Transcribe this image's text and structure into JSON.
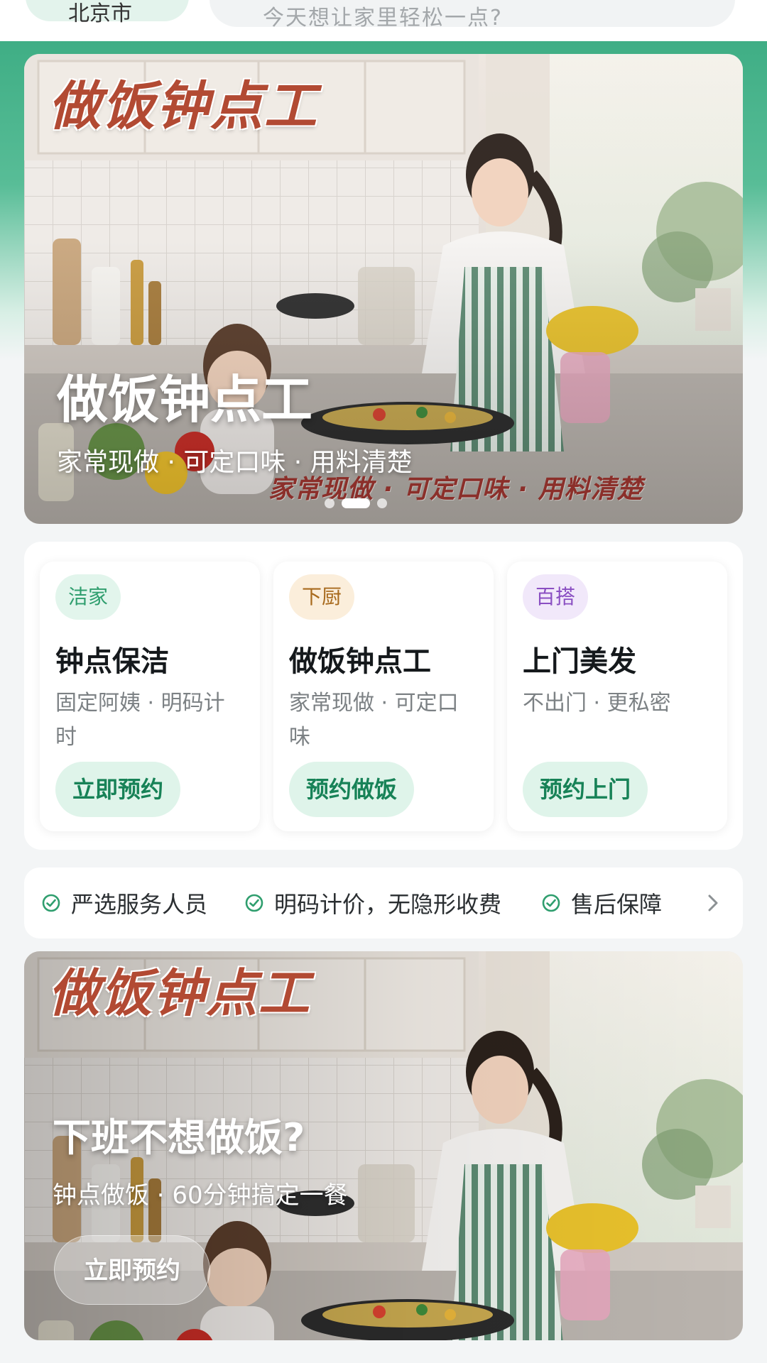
{
  "header": {
    "city": "北京市",
    "search_placeholder": "今天想让家里轻松一点?"
  },
  "banner_main": {
    "logo_text": "做饭钟点工",
    "title": "做饭钟点工",
    "subtitle": "家常现做 · 可定口味 · 用料清楚",
    "image_caption": "家常现做 · 可定口味 · 用料清楚",
    "carousel": {
      "count": 3,
      "active_index": 1
    }
  },
  "services": [
    {
      "badge": "洁家",
      "badge_color": "#2f9e6e",
      "badge_bg": "#e2f5ec",
      "title": "钟点保洁",
      "desc": "固定阿姨 · 明码计时",
      "button": "立即预约"
    },
    {
      "badge": "下厨",
      "badge_color": "#a86a1d",
      "badge_bg": "#fbeedb",
      "title": "做饭钟点工",
      "desc": "家常现做 · 可定口味",
      "button": "预约做饭"
    },
    {
      "badge": "百搭",
      "badge_color": "#8a4fc2",
      "badge_bg": "#f1e8fa",
      "title": "上门美发",
      "desc": "不出门 · 更私密",
      "button": "预约上门"
    }
  ],
  "guarantees": {
    "items": [
      "严选服务人员",
      "明码计价，无隐形收费",
      "售后保障"
    ],
    "icon": "check-circle-icon",
    "more_icon": "chevron-right-icon"
  },
  "banner_secondary": {
    "logo_text": "做饭钟点工",
    "title": "下班不想做饭?",
    "subtitle": "钟点做饭 · 60分钟搞定一餐",
    "button": "立即预约"
  },
  "colors": {
    "brand_green": "#3fae85",
    "button_bg": "#dff4ea",
    "button_text": "#178257"
  }
}
